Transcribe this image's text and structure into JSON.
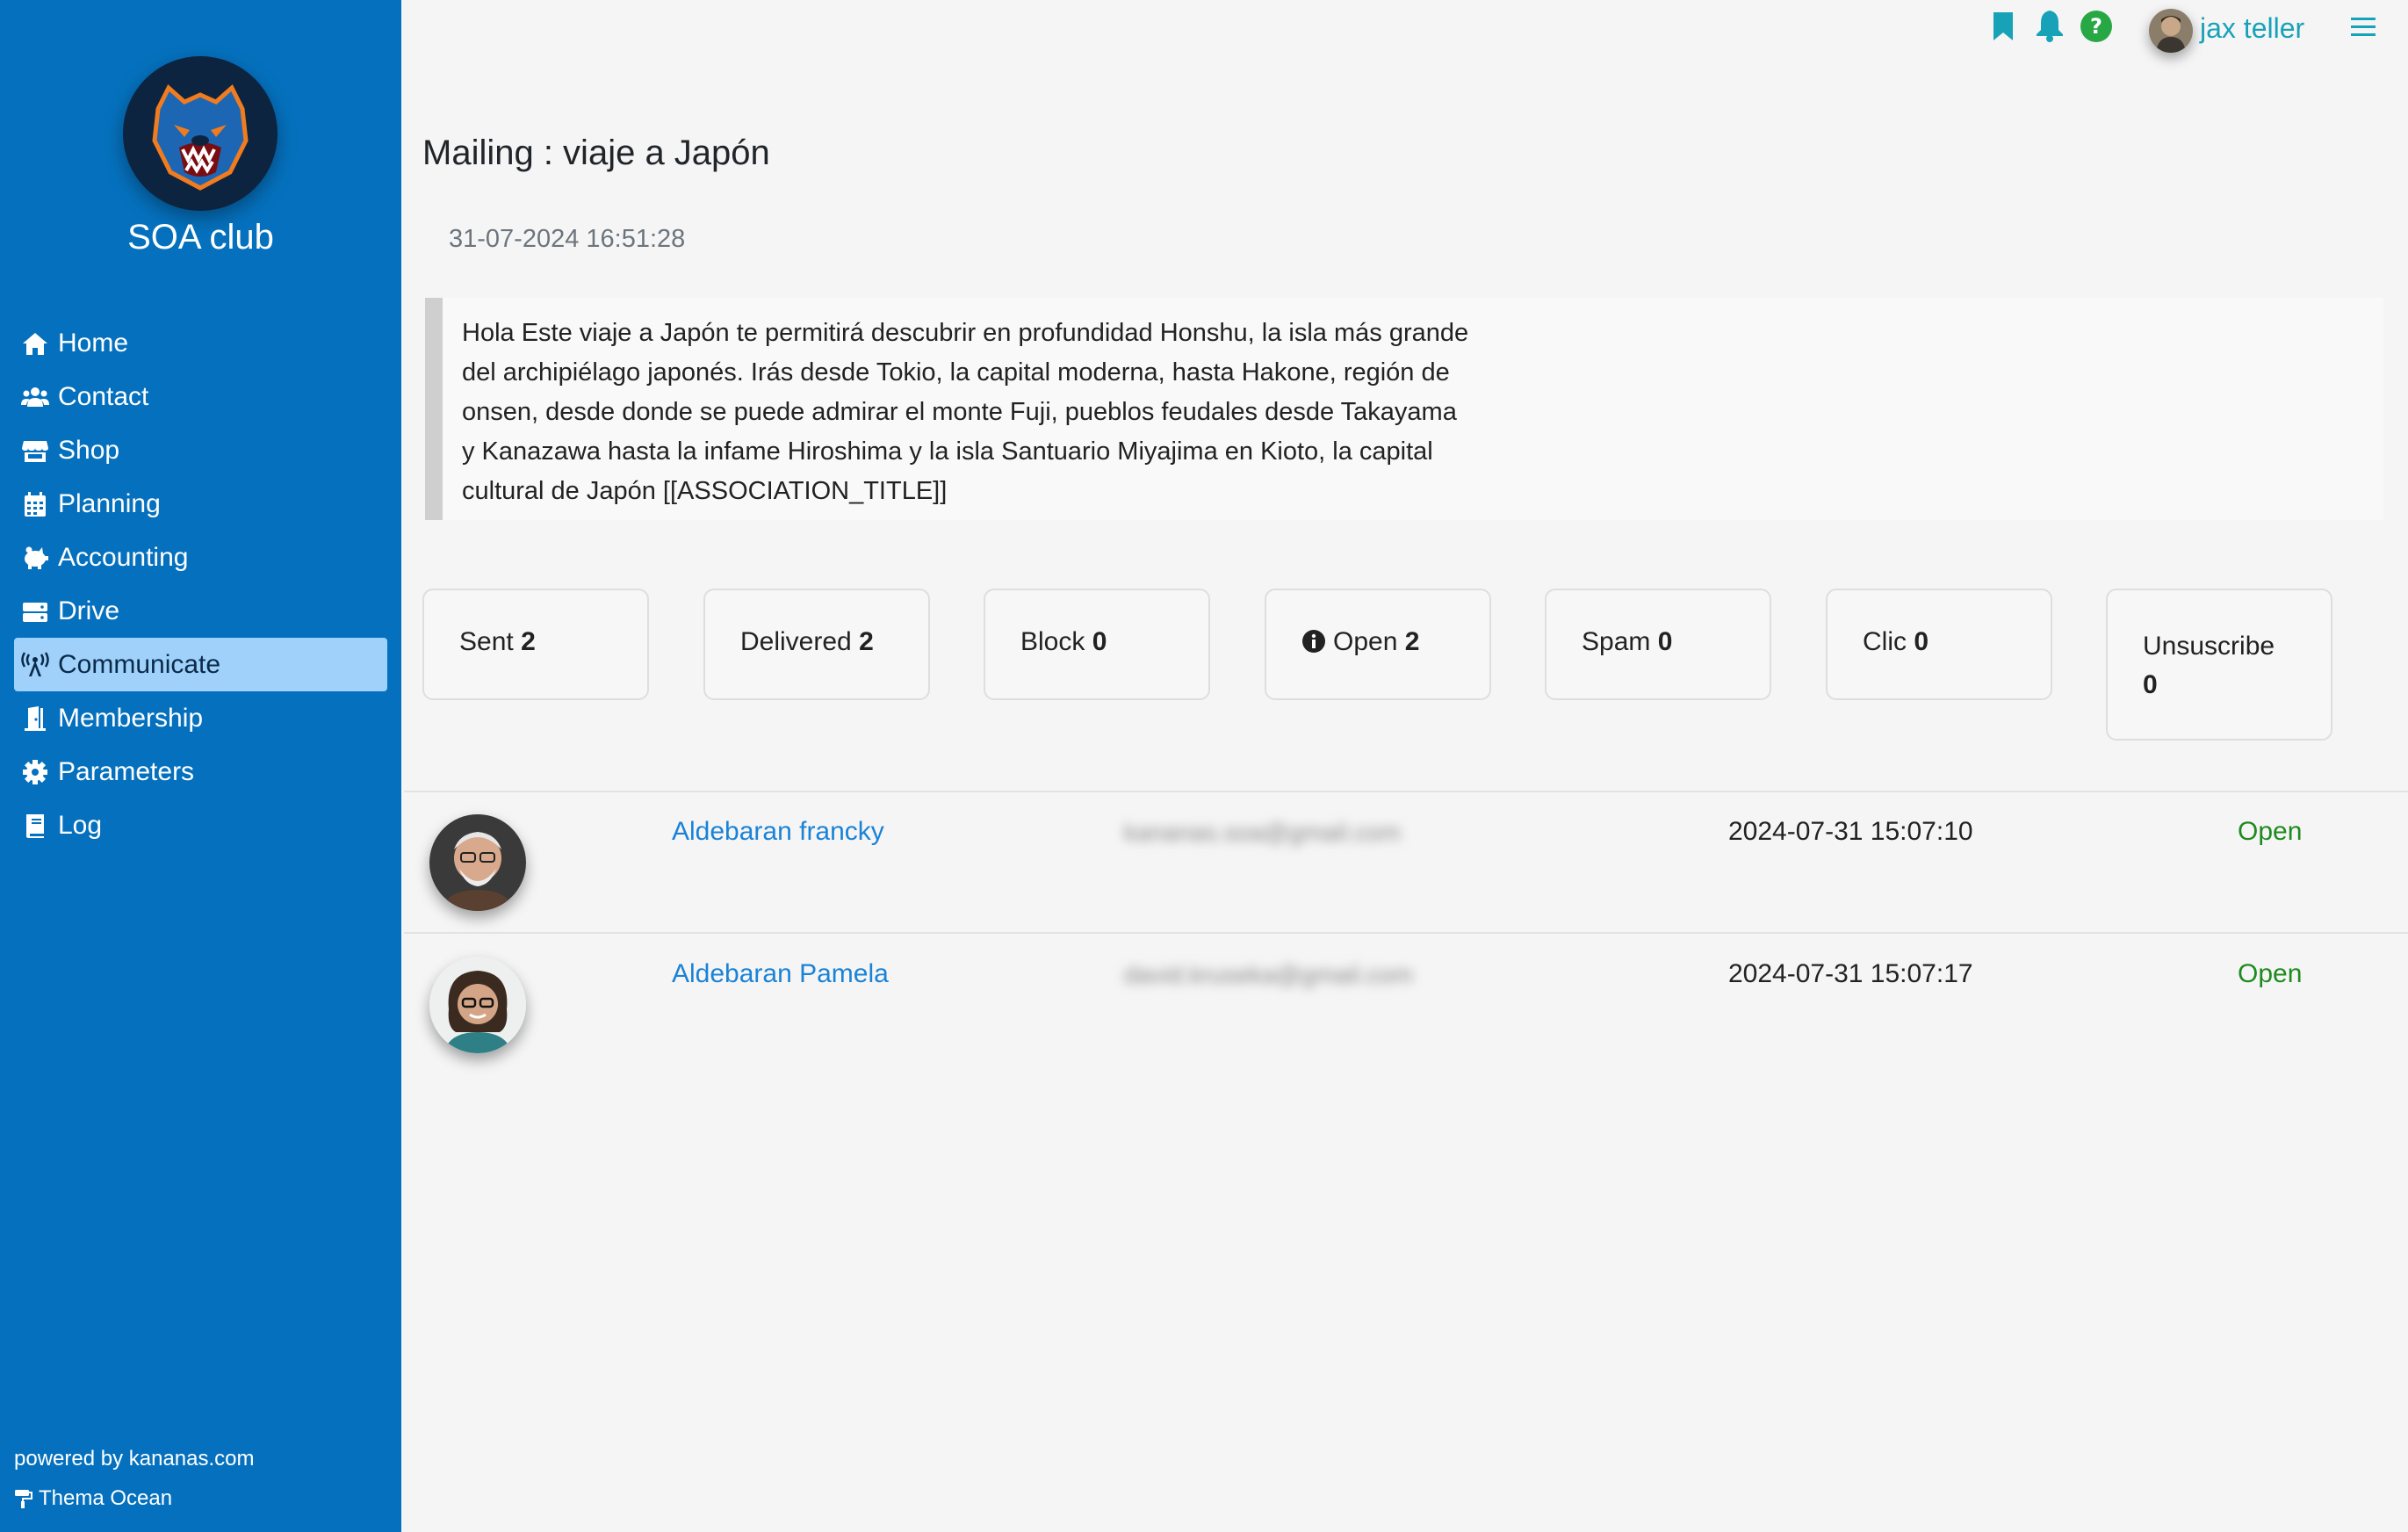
{
  "app": {
    "club_name": "SOA club",
    "powered_by": "powered by kananas.com",
    "theme": "Thema Ocean"
  },
  "nav": [
    {
      "label": "Home",
      "icon": "home-icon"
    },
    {
      "label": "Contact",
      "icon": "users-icon"
    },
    {
      "label": "Shop",
      "icon": "store-icon"
    },
    {
      "label": "Planning",
      "icon": "calendar-icon"
    },
    {
      "label": "Accounting",
      "icon": "piggy-bank-icon"
    },
    {
      "label": "Drive",
      "icon": "hard-drive-icon"
    },
    {
      "label": "Communicate",
      "icon": "broadcast-tower-icon",
      "active": true
    },
    {
      "label": "Membership",
      "icon": "door-open-icon"
    },
    {
      "label": "Parameters",
      "icon": "gear-icon"
    },
    {
      "label": "Log",
      "icon": "book-icon"
    }
  ],
  "topbar": {
    "user": "jax teller",
    "colors": {
      "bookmark": "#17a2b8",
      "bell": "#17a2b8",
      "help": "#28a745",
      "menu": "#17a2b8"
    }
  },
  "mailing": {
    "title": "Mailing : viaje a Japón",
    "date": "31-07-2024 16:51:28",
    "body": "Hola Este viaje a Japón te permitirá descubrir en profundidad Honshu, la isla más grande del archipiélago japonés. Irás desde Tokio, la capital moderna, hasta Hakone, región de onsen, desde donde se puede admirar el monte Fuji, pueblos feudales desde Takayama y Kanazawa hasta la infame Hiroshima y la isla Santuario Miyajima en Kioto, la capital cultural de Japón [[ASSOCIATION_TITLE]]"
  },
  "stats": [
    {
      "label": "Sent",
      "value": "2"
    },
    {
      "label": "Delivered",
      "value": "2"
    },
    {
      "label": "Block",
      "value": "0"
    },
    {
      "label": "Open",
      "value": "2",
      "icon": "info-circle-icon"
    },
    {
      "label": "Spam",
      "value": "0"
    },
    {
      "label": "Clic",
      "value": "0"
    },
    {
      "label": "Unsuscribe",
      "value": "0"
    }
  ],
  "recipients": [
    {
      "name": "Aldebaran francky",
      "email": "kananas.soa@gmail.com",
      "date": "2024-07-31 15:07:10",
      "status": "Open"
    },
    {
      "name": "Aldebaran Pamela",
      "email": "david.kruseka@gmail.com",
      "date": "2024-07-31 15:07:17",
      "status": "Open"
    }
  ]
}
